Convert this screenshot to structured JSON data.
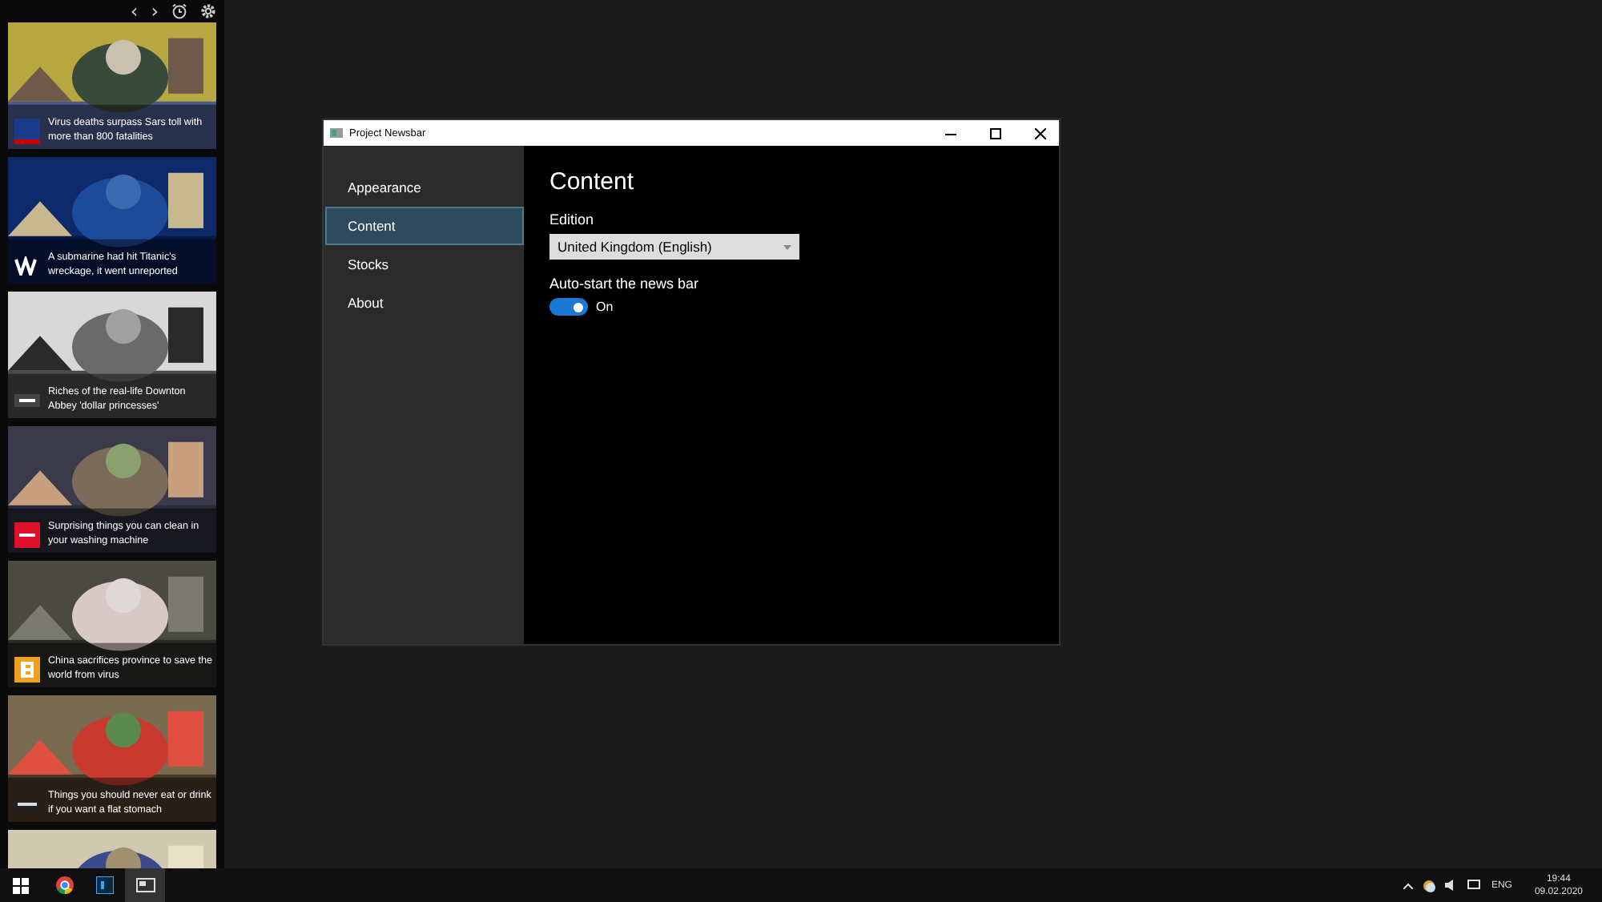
{
  "news_bar": {
    "toolbar": [
      "‹",
      "›"
    ],
    "cards": [
      {
        "kind": "story",
        "headline": "Virus deaths surpass Sars toll with more than 800 fatalities"
      },
      {
        "kind": "story",
        "headline": "A submarine had hit Titanic's wreckage, it went unreported"
      },
      {
        "kind": "story",
        "headline": "Riches of the real-life Downton Abbey 'dollar princesses'"
      },
      {
        "kind": "story",
        "headline": "Surprising things you can clean in your washing machine"
      },
      {
        "kind": "story",
        "headline": "China sacrifices province to save the world from virus"
      },
      {
        "kind": "story",
        "headline": "Things you should never eat or drink if you want a flat stomach"
      },
      {
        "kind": "picture"
      }
    ]
  },
  "window": {
    "title": "Project Newsbar",
    "nav": [
      {
        "label": "Appearance",
        "selected": false
      },
      {
        "label": "Content",
        "selected": true
      },
      {
        "label": "Stocks",
        "selected": false
      },
      {
        "label": "About",
        "selected": false
      }
    ],
    "heading": "Content",
    "edition": {
      "label": "Edition",
      "value": "United Kingdom (English)"
    },
    "autostart": {
      "label": "Auto-start the news bar",
      "on": true,
      "state_text": "On"
    }
  },
  "taskbar": {
    "language": "ENG",
    "time": "19:44",
    "date": "09.02.2020"
  }
}
